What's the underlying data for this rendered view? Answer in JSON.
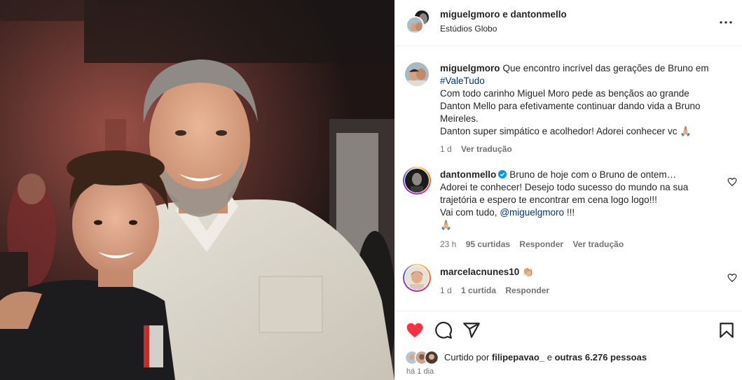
{
  "header": {
    "title": "miguelgmoro e dantonmello",
    "location": "Estúdios Globo"
  },
  "caption": {
    "username": "miguelgmoro",
    "text1": "Que encontro incrível das gerações de Bruno em",
    "hashtag": "#ValeTudo",
    "text2": "Com todo carinho Miguel Moro pede as bençãos ao grande Danton Mello para efetivamente continuar dando vida a Bruno Meireles.",
    "text3": "Danton super simpático e acolhedor! Adorei conhecer vc 🙏🏼",
    "time": "1 d",
    "translate": "Ver tradução"
  },
  "comments": [
    {
      "username": "dantonmello",
      "verified": true,
      "line1": "Bruno de hoje com o Bruno de ontem…",
      "line2": "Adorei te conhecer! Desejo todo sucesso do mundo na sua trajetória e espero te encontrar em cena logo logo!!!",
      "line3_prefix": "Vai com tudo,",
      "mention": "@miguelgmoro",
      "line3_suffix": "!!!",
      "line4": "🙏🏼",
      "time": "23 h",
      "likes": "95 curtidas",
      "reply": "Responder",
      "translate": "Ver tradução"
    },
    {
      "username": "marcelacnunes10",
      "text": "👏🏼",
      "time": "1 d",
      "likes": "1 curtida",
      "reply": "Responder"
    }
  ],
  "likes": {
    "prefix": "Curtido por",
    "user": "filipepavao_",
    "middle": "e",
    "others": "outras 6.276 pessoas"
  },
  "date": "há 1 dia",
  "colors": {
    "like_red": "#ff3040",
    "link_blue": "#00376b",
    "muted": "#737373",
    "verified_blue": "#0095f6"
  },
  "icons": {
    "more": "more-options-icon",
    "like": "heart-filled-icon",
    "comment": "comment-icon",
    "share": "share-icon",
    "save": "bookmark-icon"
  }
}
